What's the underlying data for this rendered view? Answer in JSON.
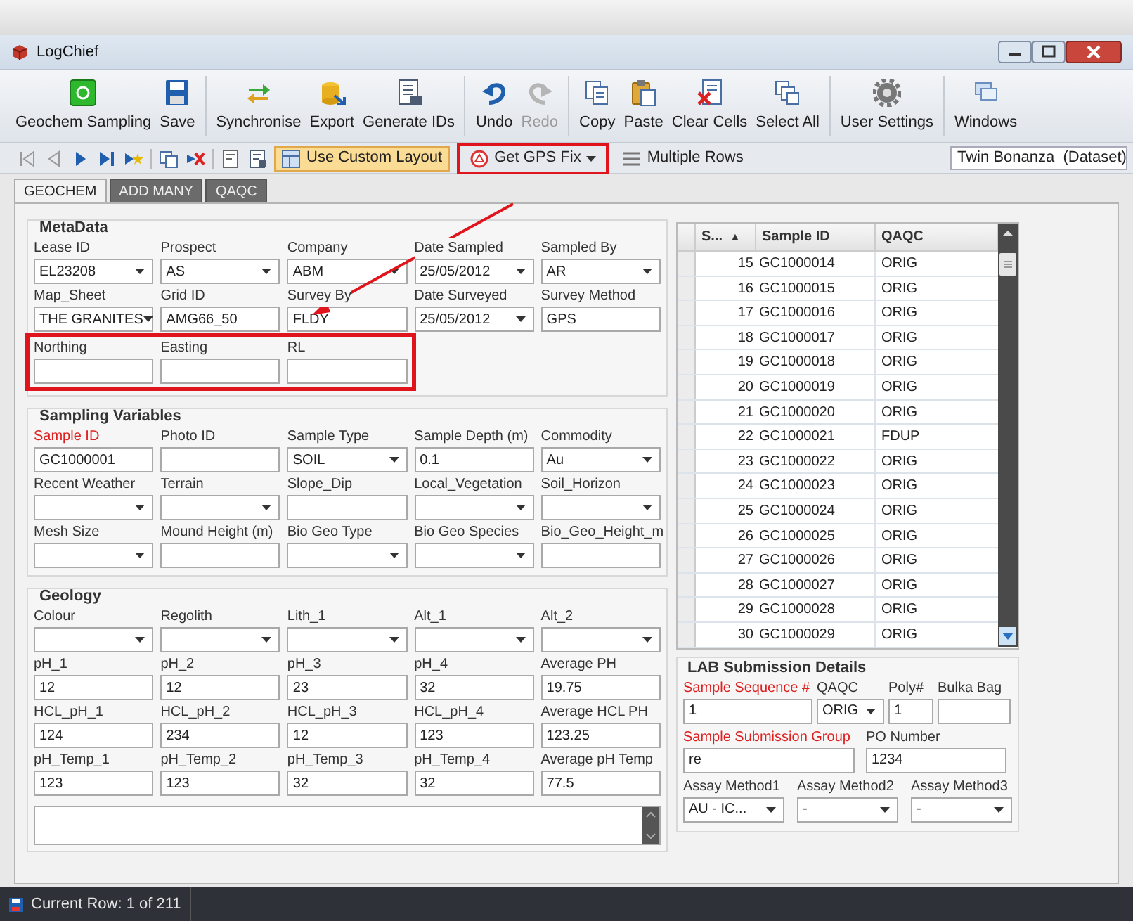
{
  "window": {
    "title": "LogChief"
  },
  "ribbon": [
    {
      "kind": "geochem",
      "label": "Geochem Sampling",
      "disabled": false
    },
    {
      "kind": "save",
      "label": "Save",
      "disabled": false
    },
    {
      "kind": "sync",
      "label": "Synchronise",
      "disabled": false
    },
    {
      "kind": "export",
      "label": "Export",
      "disabled": false
    },
    {
      "kind": "ids",
      "label": "Generate IDs",
      "disabled": false
    },
    {
      "kind": "undo",
      "label": "Undo",
      "disabled": false
    },
    {
      "kind": "redo",
      "label": "Redo",
      "disabled": true
    },
    {
      "kind": "copy",
      "label": "Copy",
      "disabled": false
    },
    {
      "kind": "paste",
      "label": "Paste",
      "disabled": false
    },
    {
      "kind": "clear",
      "label": "Clear Cells",
      "disabled": false
    },
    {
      "kind": "selectall",
      "label": "Select All",
      "disabled": false
    },
    {
      "kind": "settings",
      "label": "User Settings",
      "disabled": false
    },
    {
      "kind": "windows",
      "label": "Windows",
      "disabled": false
    }
  ],
  "toolbar": {
    "custom_layout": {
      "label": "Use Custom Layout",
      "selected": true
    },
    "gps_fix": {
      "label": "Get GPS Fix",
      "highlighted": true
    },
    "multiple_rows": {
      "label": "Multiple Rows"
    },
    "dataset": "Twin Bonanza  (Dataset)"
  },
  "tabs": [
    {
      "label": "GEOCHEM",
      "selected": true
    },
    {
      "label": "ADD MANY",
      "selected": false
    },
    {
      "label": "QAQC",
      "selected": false
    }
  ],
  "groups": [
    {
      "title": "MetaData",
      "rows": [
        {
          "highlighted": false,
          "fields": [
            {
              "label": "Lease ID",
              "kind": "dropdown",
              "value": "EL23208"
            },
            {
              "label": "Prospect",
              "kind": "dropdown",
              "value": "AS"
            },
            {
              "label": "Company",
              "kind": "dropdown",
              "value": "ABM"
            },
            {
              "label": "Date Sampled",
              "kind": "dropdown",
              "value": "25/05/2012"
            },
            {
              "label": "Sampled By",
              "kind": "dropdown",
              "value": "AR"
            }
          ]
        },
        {
          "highlighted": false,
          "fields": [
            {
              "label": "Map_Sheet",
              "kind": "dropdown",
              "value": "THE GRANITES"
            },
            {
              "label": "Grid ID",
              "kind": "text",
              "value": "AMG66_50"
            },
            {
              "label": "Survey By",
              "kind": "text",
              "value": "FLDY"
            },
            {
              "label": "Date Surveyed",
              "kind": "dropdown",
              "value": "25/05/2012"
            },
            {
              "label": "Survey Method",
              "kind": "text",
              "value": "GPS"
            }
          ]
        },
        {
          "highlighted": true,
          "fields": [
            {
              "label": "Northing",
              "kind": "text"
            },
            {
              "label": "Easting",
              "kind": "text"
            },
            {
              "label": "RL",
              "kind": "text"
            }
          ]
        }
      ]
    },
    {
      "title": "Sampling Variables",
      "rows": [
        {
          "highlighted": false,
          "fields": [
            {
              "label": "Sample ID",
              "kind": "text",
              "value": "GC1000001",
              "required": true
            },
            {
              "label": "Photo ID",
              "kind": "text"
            },
            {
              "label": "Sample Type",
              "kind": "dropdown",
              "value": "SOIL"
            },
            {
              "label": "Sample Depth (m)",
              "kind": "text",
              "value": "0.1"
            },
            {
              "label": "Commodity",
              "kind": "dropdown",
              "value": "Au"
            }
          ]
        },
        {
          "highlighted": false,
          "fields": [
            {
              "label": "Recent Weather",
              "kind": "dropdown"
            },
            {
              "label": "Terrain",
              "kind": "dropdown"
            },
            {
              "label": "Slope_Dip",
              "kind": "text"
            },
            {
              "label": "Local_Vegetation",
              "kind": "dropdown"
            },
            {
              "label": "Soil_Horizon",
              "kind": "dropdown"
            }
          ]
        },
        {
          "highlighted": false,
          "fields": [
            {
              "label": "Mesh Size",
              "kind": "dropdown"
            },
            {
              "label": "Mound Height (m)",
              "kind": "text"
            },
            {
              "label": "Bio Geo Type",
              "kind": "dropdown"
            },
            {
              "label": "Bio Geo Species",
              "kind": "dropdown"
            },
            {
              "label": "Bio_Geo_Height_m",
              "kind": "text"
            }
          ]
        }
      ]
    },
    {
      "title": "Geology",
      "notes_box": true,
      "rows": [
        {
          "highlighted": false,
          "fields": [
            {
              "label": "Colour",
              "kind": "dropdown"
            },
            {
              "label": "Regolith",
              "kind": "dropdown"
            },
            {
              "label": "Lith_1",
              "kind": "dropdown"
            },
            {
              "label": "Alt_1",
              "kind": "dropdown"
            },
            {
              "label": "Alt_2",
              "kind": "dropdown"
            }
          ]
        },
        {
          "highlighted": false,
          "fields": [
            {
              "label": "pH_1",
              "kind": "text",
              "value": "12"
            },
            {
              "label": "pH_2",
              "kind": "text",
              "value": "12"
            },
            {
              "label": "pH_3",
              "kind": "text",
              "value": "23"
            },
            {
              "label": "pH_4",
              "kind": "text",
              "value": "32"
            },
            {
              "label": "Average PH",
              "kind": "text",
              "value": "19.75"
            }
          ]
        },
        {
          "highlighted": false,
          "fields": [
            {
              "label": "HCL_pH_1",
              "kind": "text",
              "value": "124"
            },
            {
              "label": "HCL_pH_2",
              "kind": "text",
              "value": "234"
            },
            {
              "label": "HCL_pH_3",
              "kind": "text",
              "value": "12"
            },
            {
              "label": "HCL_pH_4",
              "kind": "text",
              "value": "123"
            },
            {
              "label": "Average HCL PH",
              "kind": "text",
              "value": "123.25"
            }
          ]
        },
        {
          "highlighted": false,
          "fields": [
            {
              "label": "pH_Temp_1",
              "kind": "text",
              "value": "123"
            },
            {
              "label": "pH_Temp_2",
              "kind": "text",
              "value": "123"
            },
            {
              "label": "pH_Temp_3",
              "kind": "text",
              "value": "32"
            },
            {
              "label": "pH_Temp_4",
              "kind": "text",
              "value": "32"
            },
            {
              "label": "Average pH Temp",
              "kind": "text",
              "value": "77.5"
            }
          ]
        }
      ]
    }
  ],
  "grid": {
    "columns": [
      {
        "label": "S...",
        "sort_arrow": "▲"
      },
      {
        "label": "Sample ID"
      },
      {
        "label": "QAQC"
      }
    ],
    "rows": [
      [
        "15",
        "GC1000014",
        "ORIG"
      ],
      [
        "16",
        "GC1000015",
        "ORIG"
      ],
      [
        "17",
        "GC1000016",
        "ORIG"
      ],
      [
        "18",
        "GC1000017",
        "ORIG"
      ],
      [
        "19",
        "GC1000018",
        "ORIG"
      ],
      [
        "20",
        "GC1000019",
        "ORIG"
      ],
      [
        "21",
        "GC1000020",
        "ORIG"
      ],
      [
        "22",
        "GC1000021",
        "FDUP"
      ],
      [
        "23",
        "GC1000022",
        "ORIG"
      ],
      [
        "24",
        "GC1000023",
        "ORIG"
      ],
      [
        "25",
        "GC1000024",
        "ORIG"
      ],
      [
        "26",
        "GC1000025",
        "ORIG"
      ],
      [
        "27",
        "GC1000026",
        "ORIG"
      ],
      [
        "28",
        "GC1000027",
        "ORIG"
      ],
      [
        "29",
        "GC1000028",
        "ORIG"
      ],
      [
        "30",
        "GC1000029",
        "ORIG"
      ]
    ]
  },
  "lab_submission": {
    "title": "LAB Submission Details",
    "rows": [
      [
        {
          "label": "Sample Sequence #",
          "kind": "text",
          "value": "1",
          "required": true
        },
        {
          "label": "QAQC",
          "kind": "dropdown",
          "value": "ORIG"
        },
        {
          "label": "Poly#",
          "kind": "text",
          "value": "1"
        },
        {
          "label": "Bulka Bag",
          "kind": "text"
        }
      ],
      [
        {
          "label": "Sample Submission Group",
          "kind": "text",
          "value": "re",
          "required": true
        },
        {
          "label": "PO Number",
          "kind": "text",
          "value": "1234"
        }
      ],
      [
        {
          "label": "Assay Method1",
          "kind": "dropdown",
          "value": "AU - IC..."
        },
        {
          "label": "Assay Method2",
          "kind": "dropdown",
          "value": "-"
        },
        {
          "label": "Assay Method3",
          "kind": "dropdown",
          "value": "-"
        }
      ]
    ]
  },
  "annotation_arrow": true,
  "status_bar": {
    "text": "Current Row: 1 of 211"
  }
}
